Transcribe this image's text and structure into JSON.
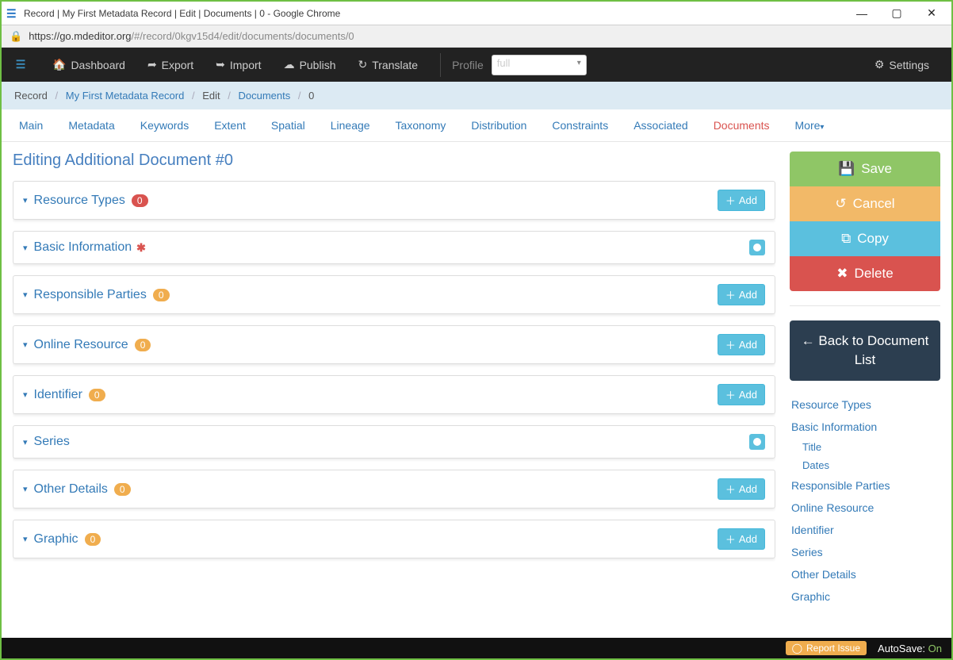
{
  "window": {
    "title": "Record | My First Metadata Record | Edit | Documents | 0 - Google Chrome"
  },
  "url": {
    "host": "https://go.mdeditor.org",
    "path": "/#/record/0kgv15d4/edit/documents/documents/0"
  },
  "topnav": {
    "dashboard": "Dashboard",
    "export": "Export",
    "import": "Import",
    "publish": "Publish",
    "translate": "Translate",
    "profile_label": "Profile",
    "profile_value": "full",
    "settings": "Settings"
  },
  "breadcrumb": {
    "record": "Record",
    "name": "My First Metadata Record",
    "edit": "Edit",
    "documents": "Documents",
    "index": "0"
  },
  "tabs": {
    "main": "Main",
    "metadata": "Metadata",
    "keywords": "Keywords",
    "extent": "Extent",
    "spatial": "Spatial",
    "lineage": "Lineage",
    "taxonomy": "Taxonomy",
    "distribution": "Distribution",
    "constraints": "Constraints",
    "associated": "Associated",
    "documents": "Documents",
    "more": "More"
  },
  "page": {
    "heading": "Editing Additional Document #0"
  },
  "panels": {
    "resource_types": {
      "title": "Resource Types",
      "count": "0",
      "add": "Add"
    },
    "basic_info": {
      "title": "Basic Information"
    },
    "responsible_parties": {
      "title": "Responsible Parties",
      "count": "0",
      "add": "Add"
    },
    "online_resource": {
      "title": "Online Resource",
      "count": "0",
      "add": "Add"
    },
    "identifier": {
      "title": "Identifier",
      "count": "0",
      "add": "Add"
    },
    "series": {
      "title": "Series"
    },
    "other_details": {
      "title": "Other Details",
      "count": "0",
      "add": "Add"
    },
    "graphic": {
      "title": "Graphic",
      "count": "0",
      "add": "Add"
    }
  },
  "sidebar": {
    "save": "Save",
    "cancel": "Cancel",
    "copy": "Copy",
    "delete": "Delete",
    "back": "Back to Document List",
    "links": {
      "resource_types": "Resource Types",
      "basic_info": "Basic Information",
      "title": "Title",
      "dates": "Dates",
      "responsible_parties": "Responsible Parties",
      "online_resource": "Online Resource",
      "identifier": "Identifier",
      "series": "Series",
      "other_details": "Other Details",
      "graphic": "Graphic"
    }
  },
  "footer": {
    "report": "Report Issue",
    "autosave_label": "AutoSave: ",
    "autosave_value": "On"
  }
}
